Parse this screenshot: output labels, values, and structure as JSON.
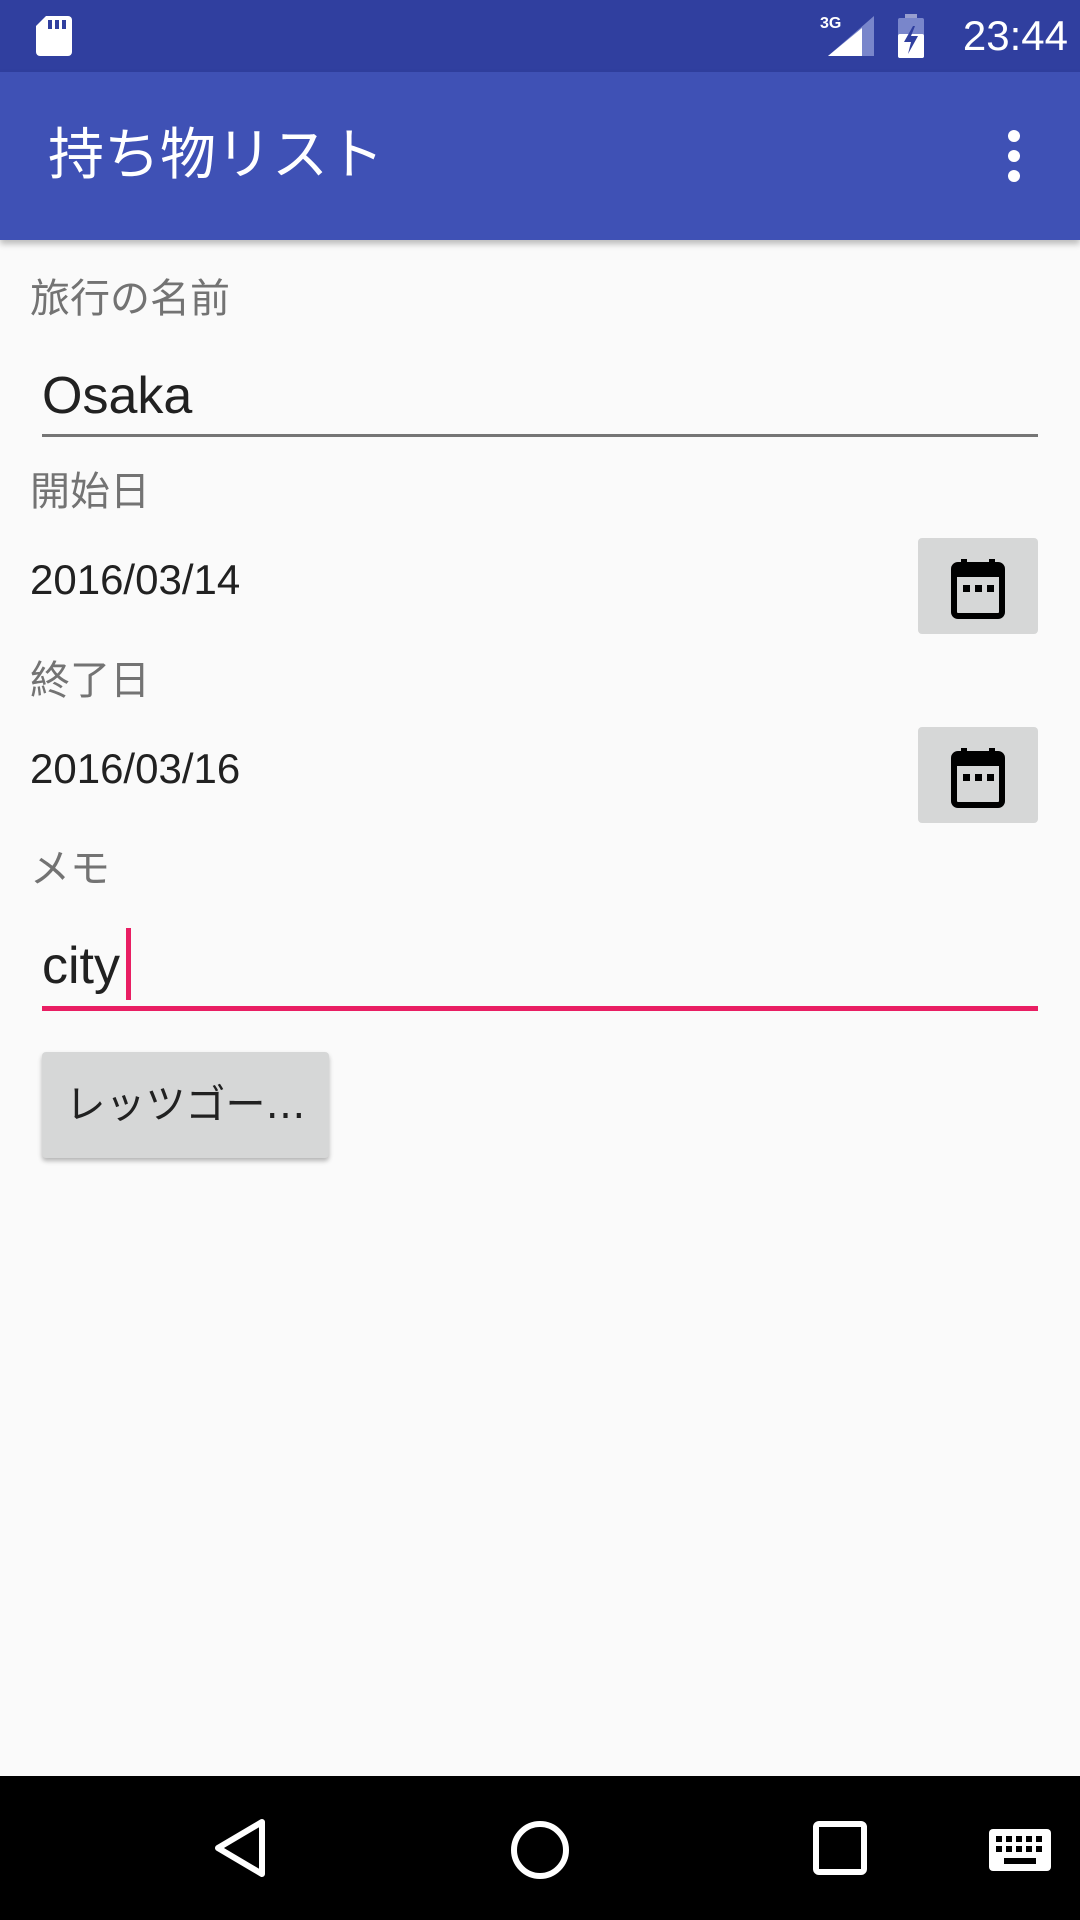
{
  "status_bar": {
    "time": "23:44",
    "network": "3G",
    "icons": [
      "sd-card-icon",
      "signal-3g-icon",
      "battery-charging-icon"
    ]
  },
  "app_bar": {
    "title": "持ち物リスト",
    "menu_icon": "more-vert-icon"
  },
  "form": {
    "trip_name_label": "旅行の名前",
    "trip_name_value": "Osaka",
    "start_label": "開始日",
    "start_date": "2016/03/14",
    "end_label": "終了日",
    "end_date": "2016/03/16",
    "memo_label": "メモ",
    "memo_value": "city",
    "calendar_icon": "calendar-icon",
    "submit_label": "レッツゴー…"
  },
  "nav_bar": {
    "icons": [
      "back-icon",
      "home-icon",
      "recents-icon",
      "keyboard-icon"
    ]
  },
  "colors": {
    "status_bar": "#303f9f",
    "app_bar": "#3f51b5",
    "accent": "#e91e63",
    "background": "#fafafa",
    "button": "#d6d7d7"
  }
}
